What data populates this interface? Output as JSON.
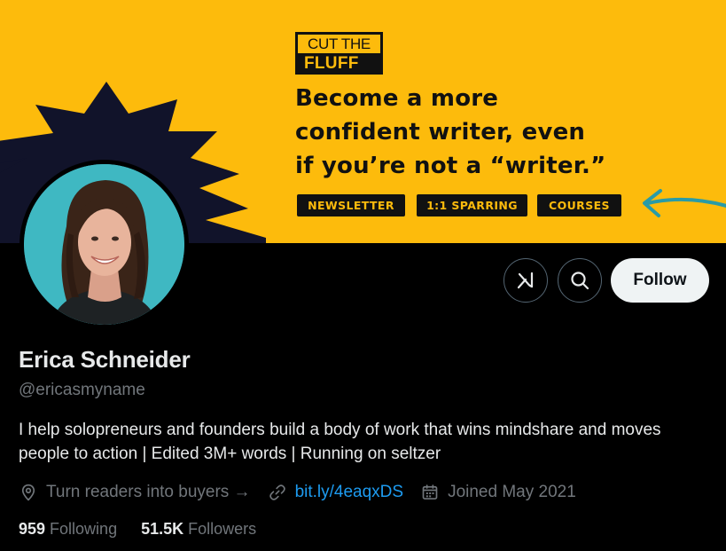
{
  "banner": {
    "logo_line1": "CUT THE",
    "logo_line2": "FLUFF",
    "headline": [
      "Become a more",
      "confident writer, even",
      "if you’re not a “writer.”"
    ],
    "tags": [
      "NEWSLETTER",
      "1:1 SPARRING",
      "COURSES"
    ],
    "background_color": "#fdbb0c",
    "burst_color": "#11132a",
    "arrow_color": "#2a9ba6"
  },
  "profile": {
    "name": "Erica Schneider",
    "handle": "@ericasmyname",
    "bio": "I help solopreneurs and founders build a body of work that wins mindshare and moves people to action | Edited 3M+ words | Running on seltzer",
    "location": "Turn readers into buyers →",
    "website": "bit.ly/4eaqxDS",
    "joined": "Joined May 2021",
    "following_count": "959",
    "following_label": "Following",
    "followers_count": "51.5K",
    "followers_label": "Followers"
  },
  "actions": {
    "grok_icon": "grok-icon",
    "search_icon": "search-icon",
    "follow_label": "Follow"
  },
  "colors": {
    "background": "#000000",
    "text_primary": "#e7e9ea",
    "text_secondary": "#71767b",
    "link": "#1d9bf0",
    "follow_bg": "#eff3f4"
  }
}
